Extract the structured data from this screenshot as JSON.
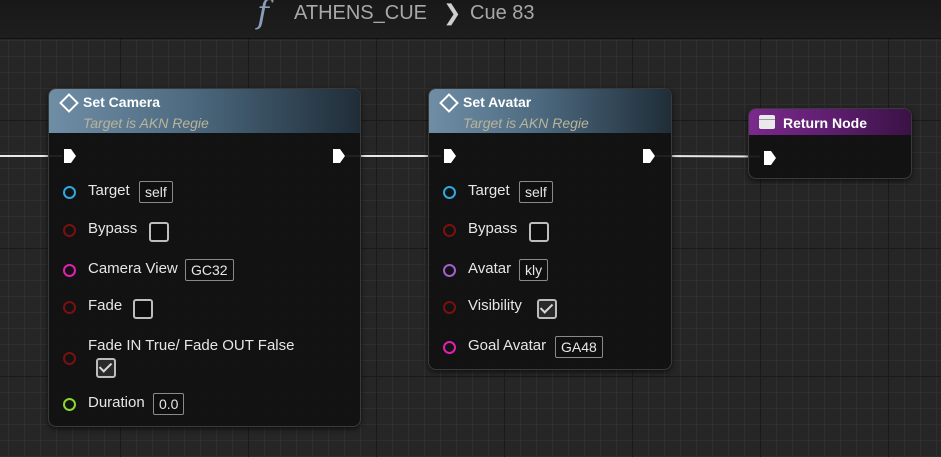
{
  "breadcrumb": {
    "icon": "function-icon",
    "parent": "ATHENS_CUE",
    "separator": "❯",
    "current": "Cue 83"
  },
  "nodes": {
    "set_camera": {
      "title": "Set Camera",
      "subtitle": "Target is AKN Regie",
      "pins": {
        "target": {
          "label": "Target",
          "value": "self",
          "color": "#2fa8e0"
        },
        "bypass": {
          "label": "Bypass",
          "checked": false,
          "color": "#7a1010"
        },
        "camera_view": {
          "label": "Camera View",
          "value": "GC32",
          "color": "#e020b0"
        },
        "fade": {
          "label": "Fade",
          "checked": false,
          "color": "#7a1010"
        },
        "fade_in": {
          "label": "Fade IN True/ Fade OUT False",
          "checked": true,
          "color": "#7a1010"
        },
        "duration": {
          "label": "Duration",
          "value": "0.0",
          "color": "#8cd630"
        }
      }
    },
    "set_avatar": {
      "title": "Set Avatar",
      "subtitle": "Target is AKN Regie",
      "pins": {
        "target": {
          "label": "Target",
          "value": "self",
          "color": "#2fa8e0"
        },
        "bypass": {
          "label": "Bypass",
          "checked": false,
          "color": "#7a1010"
        },
        "avatar": {
          "label": "Avatar",
          "value": "kly",
          "color": "#a060d0"
        },
        "visibility": {
          "label": "Visibility",
          "checked": true,
          "color": "#7a1010"
        },
        "goal_avatar": {
          "label": "Goal Avatar",
          "value": "GA48",
          "color": "#e020b0"
        }
      }
    },
    "return_node": {
      "title": "Return Node"
    }
  }
}
